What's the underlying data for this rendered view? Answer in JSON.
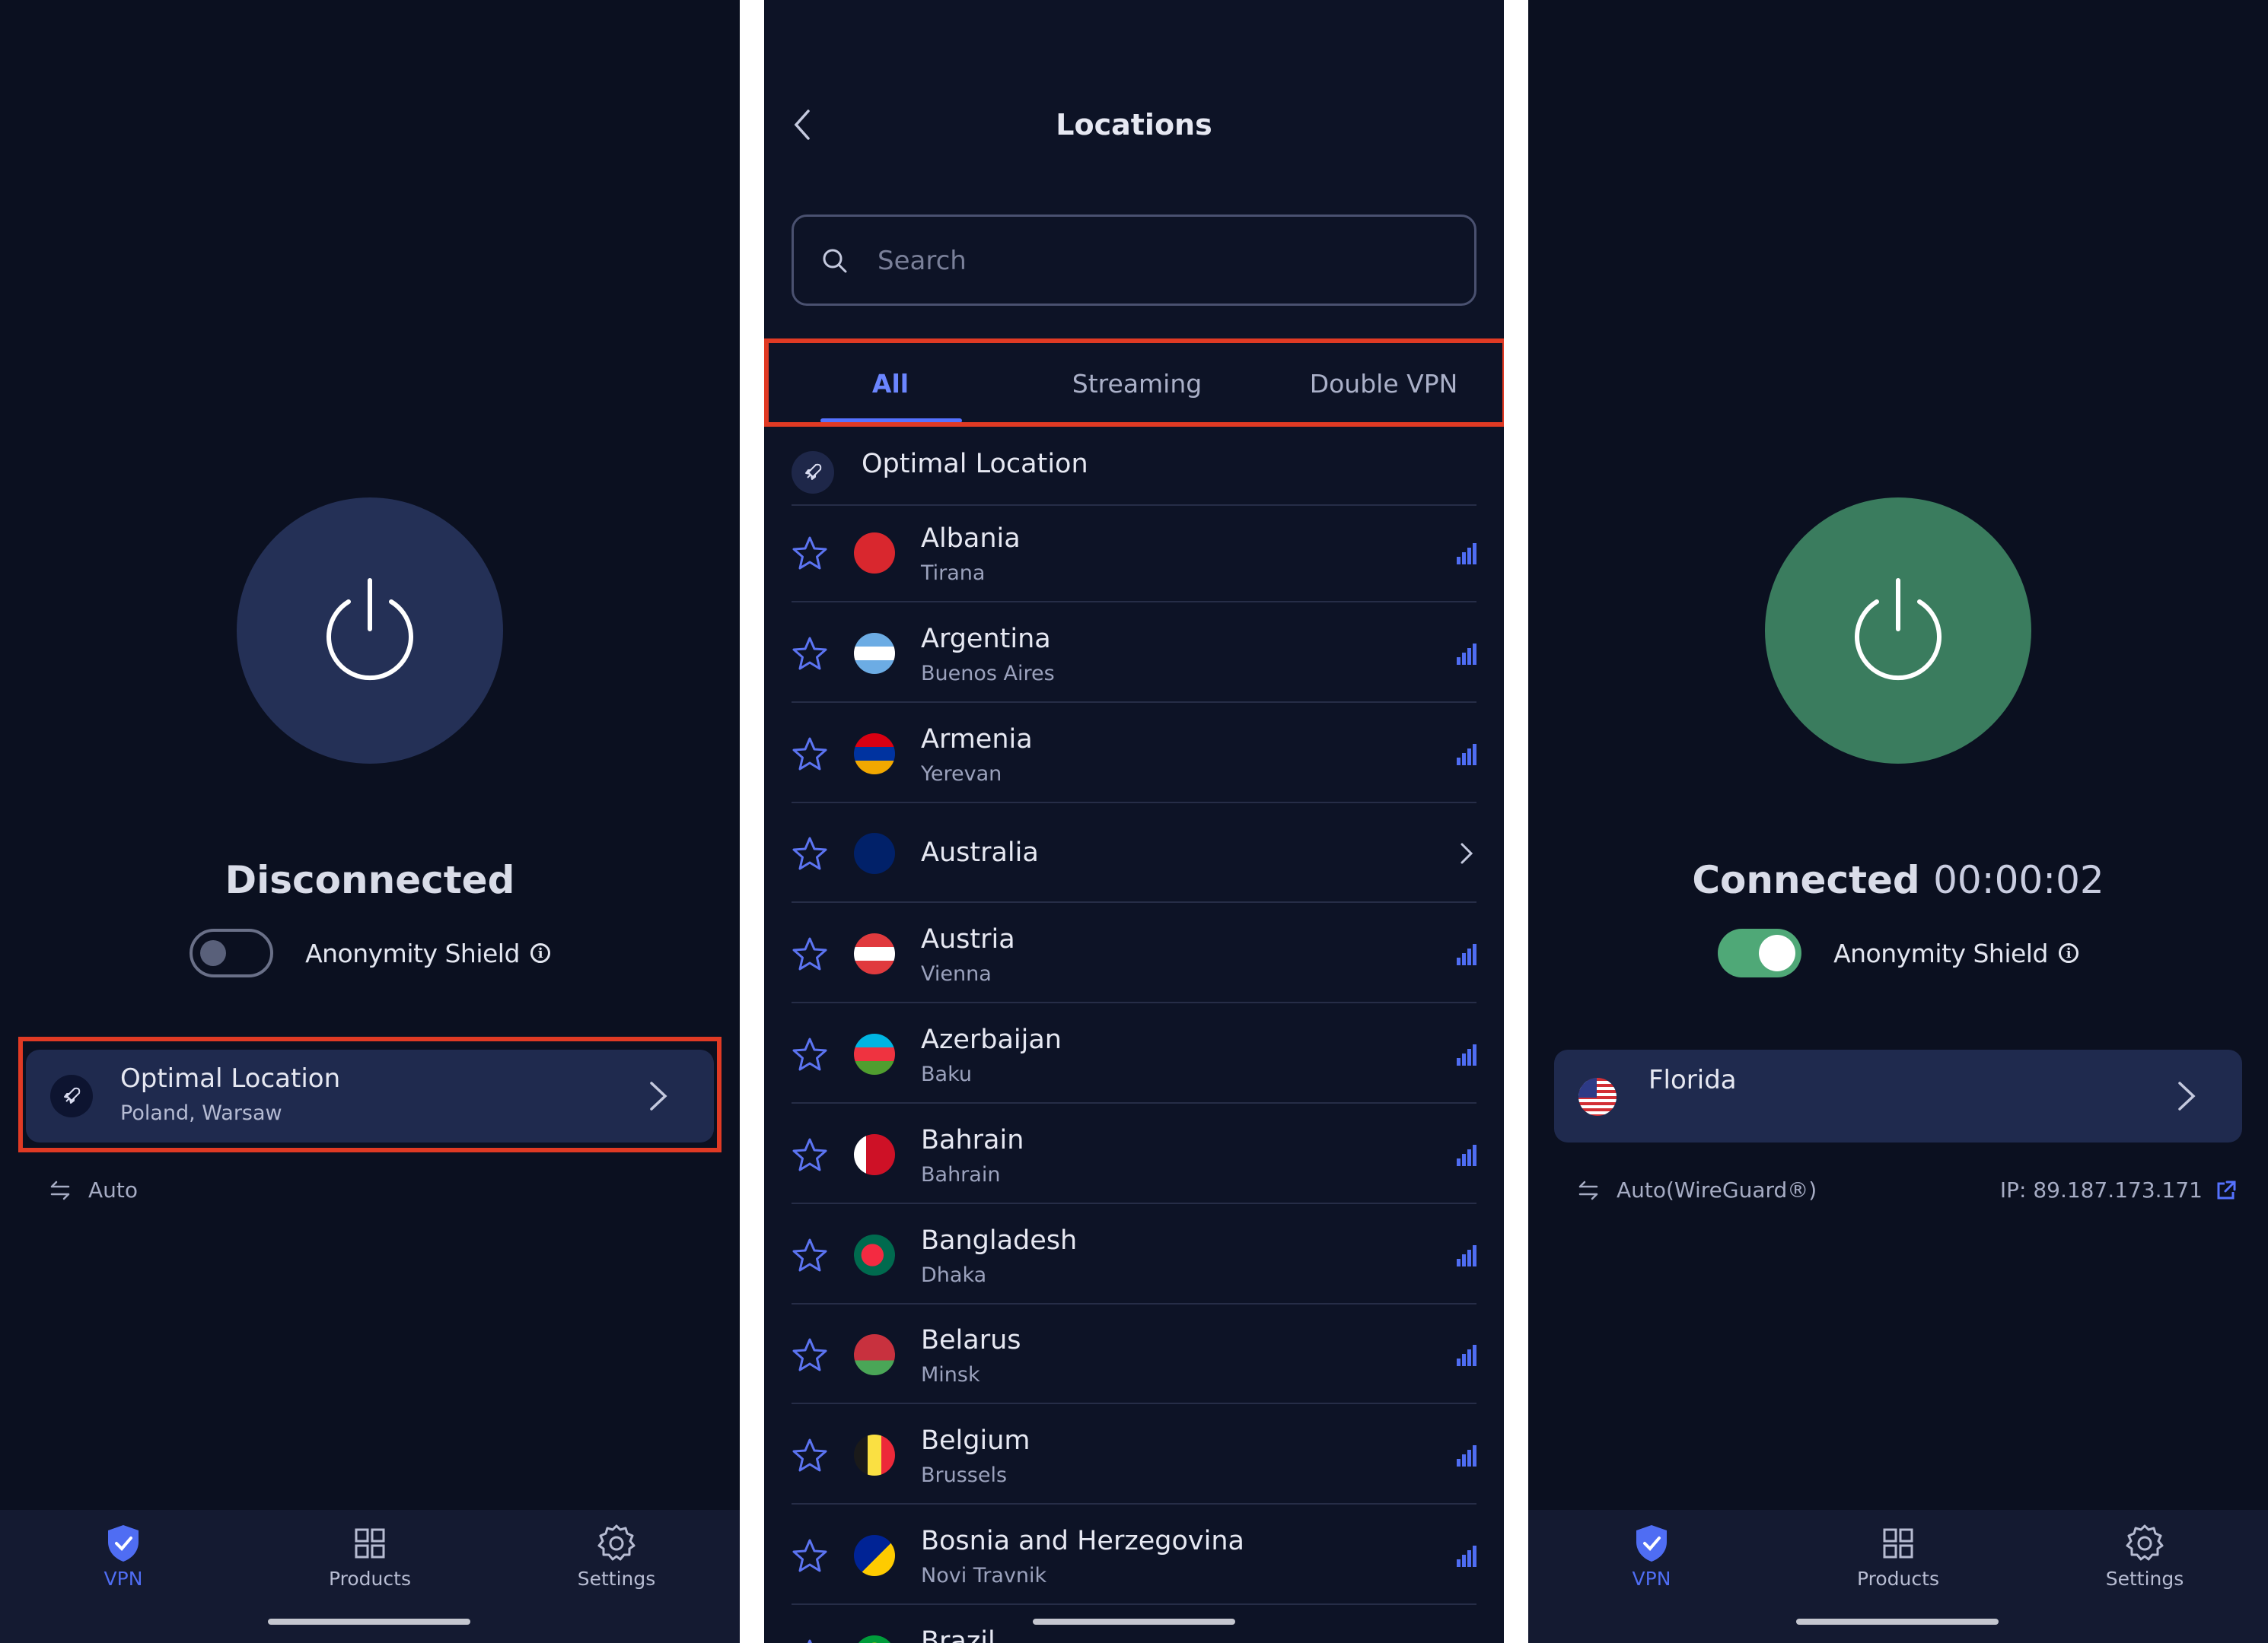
{
  "colors": {
    "panel_bg": "#0b1020",
    "accent_blue": "#5572ff",
    "connected_green": "#3a7c5e",
    "disconnected_blue": "#243056",
    "highlight_red": "#e03a24"
  },
  "screen_disconnected": {
    "status": "Disconnected",
    "anonymity_shield": {
      "label": "Anonymity Shield",
      "enabled": false
    },
    "location_card": {
      "title": "Optimal Location",
      "subtitle": "Poland, Warsaw",
      "icon": "rocket-icon"
    },
    "protocol": "Auto",
    "nav": {
      "vpn": "VPN",
      "products": "Products",
      "settings": "Settings",
      "active": "VPN"
    }
  },
  "screen_locations": {
    "title": "Locations",
    "search": {
      "placeholder": "Search",
      "value": ""
    },
    "tabs": [
      "All",
      "Streaming",
      "Double VPN"
    ],
    "active_tab": "All",
    "optimal": {
      "label": "Optimal Location",
      "icon": "rocket-icon"
    },
    "countries": [
      {
        "name": "Albania",
        "city": "Tirana",
        "flag": "albania"
      },
      {
        "name": "Argentina",
        "city": "Buenos Aires",
        "flag": "argentina"
      },
      {
        "name": "Armenia",
        "city": "Yerevan",
        "flag": "armenia"
      },
      {
        "name": "Australia",
        "city": "",
        "flag": "australia",
        "expandable": true
      },
      {
        "name": "Austria",
        "city": "Vienna",
        "flag": "austria"
      },
      {
        "name": "Azerbaijan",
        "city": "Baku",
        "flag": "azerbaijan"
      },
      {
        "name": "Bahrain",
        "city": "Bahrain",
        "flag": "bahrain"
      },
      {
        "name": "Bangladesh",
        "city": "Dhaka",
        "flag": "bangladesh"
      },
      {
        "name": "Belarus",
        "city": "Minsk",
        "flag": "belarus"
      },
      {
        "name": "Belgium",
        "city": "Brussels",
        "flag": "belgium"
      },
      {
        "name": "Bosnia and Herzegovina",
        "city": "Novi Travnik",
        "flag": "bosnia"
      },
      {
        "name": "Brazil",
        "city": "",
        "flag": "brazil"
      }
    ]
  },
  "screen_connected": {
    "status": "Connected",
    "timer": "00:00:02",
    "anonymity_shield": {
      "label": "Anonymity Shield",
      "enabled": true
    },
    "location_card": {
      "title": "Florida",
      "flag": "united-states"
    },
    "protocol": "Auto(WireGuard®)",
    "ip": "IP: 89.187.173.171",
    "nav": {
      "vpn": "VPN",
      "products": "Products",
      "settings": "Settings",
      "active": "VPN"
    }
  }
}
